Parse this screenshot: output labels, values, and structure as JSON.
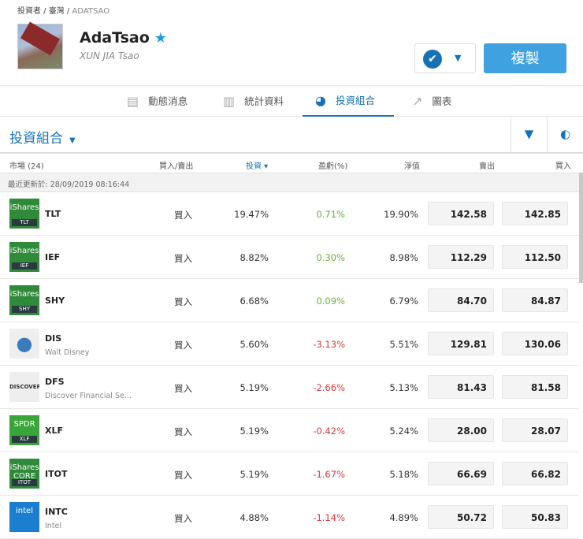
{
  "breadcrumb": [
    "投資者",
    "臺灣",
    "ADATSAO"
  ],
  "profile": {
    "username": "AdaTsao",
    "full_name": "XUN JIA Tsao"
  },
  "buttons": {
    "copy": "複製"
  },
  "tabs": [
    {
      "label": "動態消息",
      "icon": "news-icon"
    },
    {
      "label": "統計資料",
      "icon": "bar-chart-icon"
    },
    {
      "label": "投資組合",
      "icon": "pie-chart-icon",
      "active": true
    },
    {
      "label": "圖表",
      "icon": "trend-icon"
    }
  ],
  "portfolio": {
    "title": "投資組合"
  },
  "columns": {
    "market": "市場 (24)",
    "action": "買入/賣出",
    "invested": "投資",
    "pnl": "盈虧(%)",
    "value": "淨值",
    "sell": "賣出",
    "buy": "買入"
  },
  "updated": "最近更新於: 28/09/2019 08:16:44",
  "rows": [
    {
      "ticker": "TLT",
      "name": "",
      "logo_top": "iShares",
      "logo_bot": "TLT",
      "logo_color": "#2f8a3a",
      "action": "買入",
      "invested": "19.47%",
      "pnl": "0.71%",
      "pnl_dir": "up",
      "value": "19.90%",
      "sell": "142.58",
      "buy": "142.85"
    },
    {
      "ticker": "IEF",
      "name": "",
      "logo_top": "iShares",
      "logo_bot": "IEF",
      "logo_color": "#2f8a3a",
      "action": "買入",
      "invested": "8.82%",
      "pnl": "0.30%",
      "pnl_dir": "up",
      "value": "8.98%",
      "sell": "112.29",
      "buy": "112.50"
    },
    {
      "ticker": "SHY",
      "name": "",
      "logo_top": "iShares",
      "logo_bot": "SHY",
      "logo_color": "#2f8a3a",
      "action": "買入",
      "invested": "6.68%",
      "pnl": "0.09%",
      "pnl_dir": "up",
      "value": "6.79%",
      "sell": "84.70",
      "buy": "84.87"
    },
    {
      "ticker": "DIS",
      "name": "Walt Disney",
      "logo_top": "",
      "logo_bot": "",
      "logo_color": "#eeeeee",
      "action": "買入",
      "invested": "5.60%",
      "pnl": "-3.13%",
      "pnl_dir": "down",
      "value": "5.51%",
      "sell": "129.81",
      "buy": "130.06"
    },
    {
      "ticker": "DFS",
      "name": "Discover Financial Se...",
      "logo_top": "DISCOVER",
      "logo_bot": "",
      "logo_color": "#eeeeee",
      "action": "買入",
      "invested": "5.19%",
      "pnl": "-2.66%",
      "pnl_dir": "down",
      "value": "5.13%",
      "sell": "81.43",
      "buy": "81.58"
    },
    {
      "ticker": "XLF",
      "name": "",
      "logo_top": "SPDR",
      "logo_bot": "XLF",
      "logo_color": "#3aa63a",
      "action": "買入",
      "invested": "5.19%",
      "pnl": "-0.42%",
      "pnl_dir": "down",
      "value": "5.24%",
      "sell": "28.00",
      "buy": "28.07"
    },
    {
      "ticker": "ITOT",
      "name": "",
      "logo_top": "iShares CORE",
      "logo_bot": "ITOT",
      "logo_color": "#2f8a3a",
      "action": "買入",
      "invested": "5.19%",
      "pnl": "-1.67%",
      "pnl_dir": "down",
      "value": "5.18%",
      "sell": "66.69",
      "buy": "66.82"
    },
    {
      "ticker": "INTC",
      "name": "Intel",
      "logo_top": "intel",
      "logo_bot": "",
      "logo_color": "#1a7fd0",
      "action": "買入",
      "invested": "4.88%",
      "pnl": "-1.14%",
      "pnl_dir": "down",
      "value": "4.89%",
      "sell": "50.72",
      "buy": "50.83"
    }
  ]
}
